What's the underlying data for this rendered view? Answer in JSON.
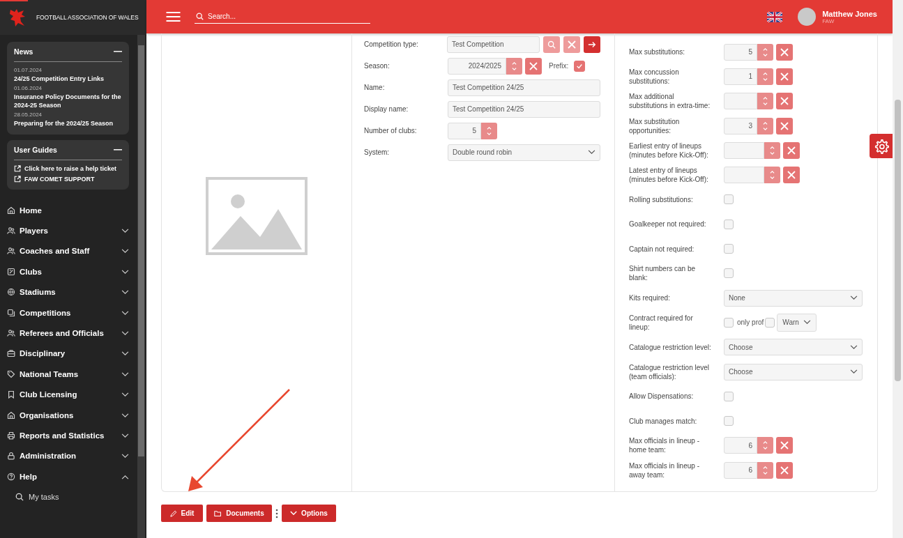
{
  "sidebar": {
    "brand": "FOOTBALL ASSOCIATION OF WALES",
    "news": {
      "title": "News",
      "items": [
        {
          "date": "01.07.2024",
          "title": "24/25 Competition Entry Links"
        },
        {
          "date": "01.06.2024",
          "title": "Insurance Policy Documents for the 2024-25 Season"
        },
        {
          "date": "28.05.2024",
          "title": "Preparing for the 2024/25 Season"
        }
      ]
    },
    "guides": {
      "title": "User Guides",
      "links": [
        "Click here to raise a help ticket",
        "FAW COMET SUPPORT"
      ]
    },
    "nav": [
      {
        "label": "Home",
        "kind": "link"
      },
      {
        "label": "Players",
        "kind": "group",
        "expanded": false
      },
      {
        "label": "Coaches and Staff",
        "kind": "group",
        "expanded": false
      },
      {
        "label": "Clubs",
        "kind": "group",
        "expanded": false
      },
      {
        "label": "Stadiums",
        "kind": "group",
        "expanded": false
      },
      {
        "label": "Competitions",
        "kind": "group",
        "expanded": false
      },
      {
        "label": "Referees and Officials",
        "kind": "group",
        "expanded": false
      },
      {
        "label": "Disciplinary",
        "kind": "group",
        "expanded": false
      },
      {
        "label": "National Teams",
        "kind": "group",
        "expanded": false
      },
      {
        "label": "Club Licensing",
        "kind": "group",
        "expanded": false
      },
      {
        "label": "Organisations",
        "kind": "group",
        "expanded": false
      },
      {
        "label": "Reports and Statistics",
        "kind": "group",
        "expanded": false
      },
      {
        "label": "Administration",
        "kind": "group",
        "expanded": false
      },
      {
        "label": "Help",
        "kind": "group",
        "expanded": true,
        "children": [
          {
            "label": "My tasks"
          }
        ]
      }
    ]
  },
  "header": {
    "search": {
      "placeholder": "Search..."
    },
    "user": {
      "name": "Matthew Jones",
      "org": "FAW"
    }
  },
  "form": {
    "left": [
      {
        "kind": "lookup",
        "label": "Competition type:",
        "value": "Test Competition"
      },
      {
        "kind": "season",
        "label": "Season:",
        "value": "2024/2025",
        "prefix_label": "Prefix:",
        "prefix_checked": true
      },
      {
        "kind": "text",
        "label": "Name:",
        "value": "Test Competition 24/25"
      },
      {
        "kind": "text",
        "label": "Display name:",
        "value": "Test Competition 24/25"
      },
      {
        "kind": "number",
        "label": "Number of clubs:",
        "value": "5",
        "clearable": false
      },
      {
        "kind": "select",
        "label": "System:",
        "value": "Double round robin"
      }
    ],
    "right": [
      {
        "kind": "number",
        "label": "Max substitutions:",
        "value": "5",
        "clearable": true
      },
      {
        "kind": "number",
        "label": "Max concussion substitutions:",
        "value": "1",
        "clearable": true
      },
      {
        "kind": "number",
        "label": "Max additional substitutions in extra-time:",
        "clearable": true
      },
      {
        "kind": "number",
        "label": "Max substitution opportunities:",
        "value": "3",
        "clearable": true
      },
      {
        "kind": "number",
        "label": "Earliest entry of lineups (minutes before Kick-Off):",
        "clearable": true
      },
      {
        "kind": "number",
        "label": "Latest entry of lineups (minutes before Kick-Off):",
        "clearable": true
      },
      {
        "kind": "checkbox",
        "label": "Rolling substitutions:",
        "checked": false
      },
      {
        "kind": "checkbox",
        "label": "Goalkeeper not required:",
        "checked": false
      },
      {
        "kind": "checkbox",
        "label": "Captain not required:",
        "checked": false
      },
      {
        "kind": "checkbox",
        "label": "Shirt numbers can be blank:",
        "checked": false
      },
      {
        "kind": "select",
        "label": "Kits required:",
        "value": "None"
      },
      {
        "kind": "contract",
        "label": "Contract required for lineup:",
        "checked": false,
        "option_label": "only prof",
        "option_checked": false,
        "mode": "Warn"
      },
      {
        "kind": "select",
        "label": "Catalogue restriction level:",
        "value": "Choose"
      },
      {
        "kind": "select",
        "label": "Catalogue restriction level (team officials):",
        "value": "Choose"
      },
      {
        "kind": "checkbox",
        "label": "Allow Dispensations:",
        "checked": false
      },
      {
        "kind": "checkbox",
        "label": "Club manages match:",
        "checked": false
      },
      {
        "kind": "number",
        "label": "Max officials in lineup - home team:",
        "value": "6",
        "clearable": true
      },
      {
        "kind": "number",
        "label": "Max officials in lineup - away team:",
        "value": "6",
        "clearable": true
      }
    ]
  },
  "actions": [
    {
      "label": "Edit"
    },
    {
      "label": "Documents"
    },
    {
      "label": "Options"
    }
  ]
}
